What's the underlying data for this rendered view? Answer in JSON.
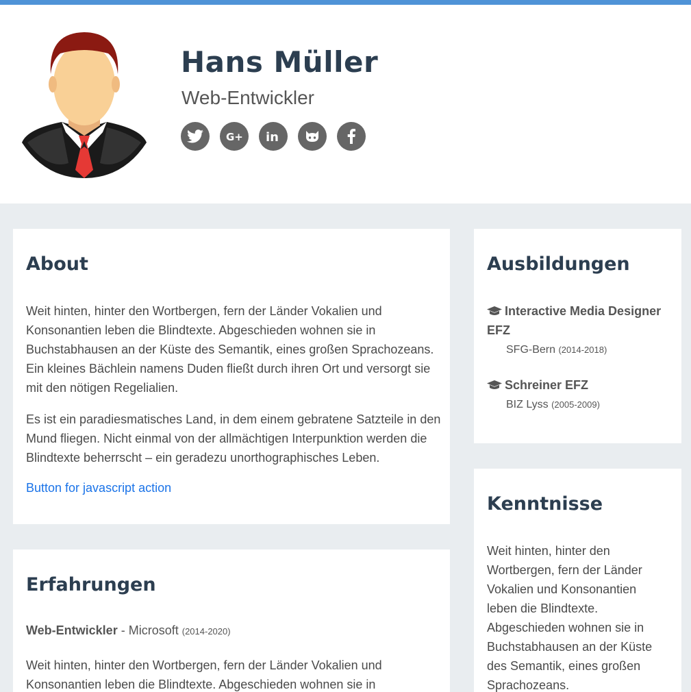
{
  "header": {
    "name": "Hans Müller",
    "title": "Web-Entwickler",
    "social": [
      "twitter-icon",
      "google-plus-icon",
      "linkedin-icon",
      "github-icon",
      "facebook-icon"
    ]
  },
  "about": {
    "heading": "About",
    "paragraph1_line1": "Weit hinten, hinter den Wortbergen, fern der Länder Vokalien und",
    "paragraph1_line2": "Konsonantien leben die Blindtexte. Abgeschieden wohnen sie in",
    "paragraph1_line3": "Buchstabhausen an der Küste des Semantik, eines großen Sprachozeans.",
    "paragraph1_line4": "Ein kleines Bächlein namens Duden fließt durch ihren Ort und versorgt sie",
    "paragraph1_line5": "mit den nötigen Regelialien.",
    "paragraph2_line1": "Es ist ein paradiesmatisches Land, in dem einem gebratene Satzteile in den",
    "paragraph2_line2": "Mund fliegen. Nicht einmal von der allmächtigen Interpunktion werden die",
    "paragraph2_line3": "Blindtexte beherrscht – ein geradezu unorthographisches Leben.",
    "action_link": "Button for javascript action"
  },
  "experience": {
    "heading": "Erfahrungen",
    "job_role": "Web-Entwickler",
    "job_separator": " - ",
    "job_company": "Microsoft",
    "job_years": "(2014-2020)",
    "text_line1": "Weit hinten, hinter den Wortbergen, fern der Länder Vokalien und",
    "text_line2": "Konsonantien leben die Blindtexte. Abgeschieden wohnen sie in"
  },
  "education": {
    "heading": "Ausbildungen",
    "items": [
      {
        "degree_line1": "Interactive Media Designer",
        "degree_line2": "EFZ",
        "school": "SFG-Bern",
        "years": "(2014-2018)"
      },
      {
        "degree_line1": "Schreiner EFZ",
        "degree_line2": "",
        "school": "BIZ Lyss",
        "years": "(2005-2009)"
      }
    ]
  },
  "skills": {
    "heading": "Kenntnisse",
    "lines": [
      "Weit hinten, hinter den",
      "Wortbergen, fern der Länder",
      "Vokalien und Konsonantien",
      "leben die Blindtexte.",
      "Abgeschieden wohnen sie in",
      "Buchstabhausen an der Küste",
      "des Semantik, eines großen",
      "Sprachozeans."
    ]
  },
  "colors": {
    "accent_bar": "#4f93d7",
    "heading": "#2c3e50",
    "link": "#1a73e8",
    "background": "#e9edf0"
  }
}
